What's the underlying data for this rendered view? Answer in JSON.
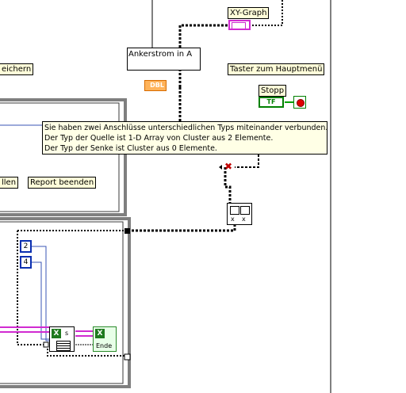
{
  "diagram": {
    "labels": {
      "xy_graph": "XY-Graph",
      "ankerstrom": "Ankerstrom in A",
      "speichern_fragment": "eichern",
      "taster": "Taster zum Hauptmenü",
      "stopp": "Stopp",
      "report_beenden": "Report beenden",
      "llen_fragment": "llen"
    },
    "terminals": {
      "dbl": "DBL",
      "tf": "TF"
    },
    "constants": {
      "c1": "2",
      "c2": "4"
    },
    "vi_labels": {
      "ende": "Ende",
      "s": "s"
    }
  },
  "tooltip": {
    "line1": "Sie haben zwei Anschlüsse unterschiedlichen Typs miteinander verbunden.",
    "line2": "Der Typ der Quelle ist 1-D Array von Cluster aus 2 Elemente.",
    "line3": "Der Typ der Senke ist Cluster aus 0 Elemente."
  },
  "colors": {
    "wire_broken": "#000000",
    "wire_blue": "#3a56b5",
    "wire_pink": "#d12ad1",
    "frame": "#000000"
  }
}
